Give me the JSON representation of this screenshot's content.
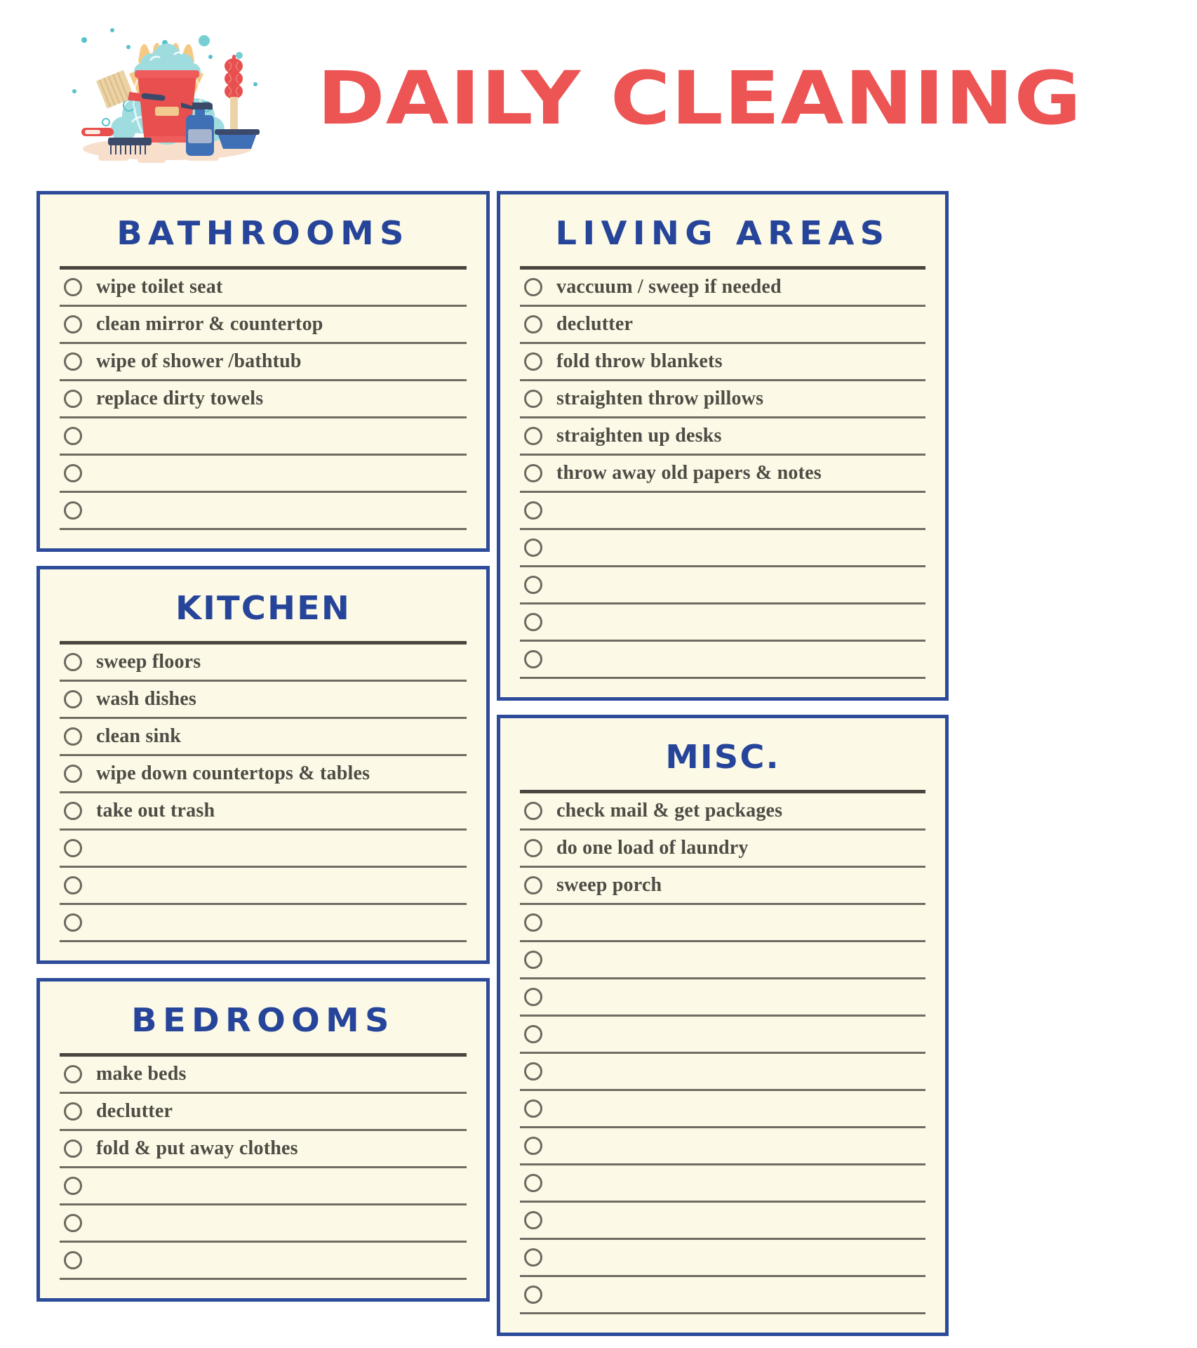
{
  "header": {
    "title": "DAILY CLEANING",
    "illustration_name": "cleaning-supplies-illustration"
  },
  "colors": {
    "title_red": "#ED5454",
    "panel_border_navy": "#2C4B9B",
    "heading_navy": "#26459A",
    "panel_bg_cream": "#FCFAE6",
    "rule_dark": "#4A453E",
    "rule_gray": "#716C63",
    "item_text": "#4F4B45"
  },
  "sections": [
    {
      "id": "bathrooms",
      "title": "BATHROOMS",
      "total_rows": 7,
      "items": [
        "wipe toilet seat",
        "clean mirror & countertop",
        "wipe of shower /bathtub",
        "replace dirty towels",
        "",
        "",
        ""
      ]
    },
    {
      "id": "kitchen",
      "title": "KITCHEN",
      "total_rows": 8,
      "items": [
        "sweep floors",
        "wash dishes",
        "clean sink",
        "wipe down countertops & tables",
        "take out trash",
        "",
        "",
        ""
      ]
    },
    {
      "id": "bedrooms",
      "title": "BEDROOMS",
      "total_rows": 6,
      "items": [
        "make beds",
        "declutter",
        "fold & put away clothes",
        "",
        "",
        ""
      ]
    },
    {
      "id": "living-areas",
      "title": "LIVING AREAS",
      "total_rows": 11,
      "items": [
        "vaccuum / sweep if needed",
        "declutter",
        "fold throw blankets",
        "straighten throw pillows",
        "straighten up desks",
        "throw away old papers & notes",
        "",
        "",
        "",
        "",
        ""
      ]
    },
    {
      "id": "misc",
      "title": "MISC.",
      "total_rows": 14,
      "items": [
        "check mail & get packages",
        "do one load of laundry",
        "sweep porch",
        "",
        "",
        "",
        "",
        "",
        "",
        "",
        "",
        "",
        "",
        ""
      ]
    }
  ]
}
